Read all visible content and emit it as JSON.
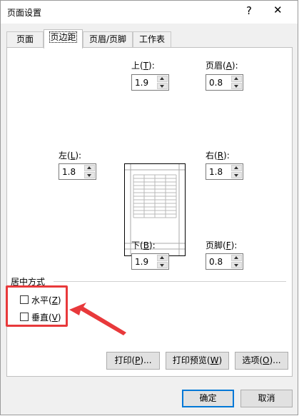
{
  "window": {
    "title": "页面设置",
    "help": "?",
    "close": "✕"
  },
  "tabs": [
    {
      "label": "页面"
    },
    {
      "label": "页边距"
    },
    {
      "label": "页眉/页脚"
    },
    {
      "label": "工作表"
    }
  ],
  "margins": {
    "top": {
      "label": "上(",
      "key": "T",
      "suffix": "):",
      "value": "1.9"
    },
    "header": {
      "label": "页眉(",
      "key": "A",
      "suffix": "):",
      "value": "0.8"
    },
    "left": {
      "label": "左(",
      "key": "L",
      "suffix": "):",
      "value": "1.8"
    },
    "right": {
      "label": "右(",
      "key": "R",
      "suffix": "):",
      "value": "1.8"
    },
    "bottom": {
      "label": "下(",
      "key": "B",
      "suffix": "):",
      "value": "1.9"
    },
    "footer": {
      "label": "页脚(",
      "key": "F",
      "suffix": "):",
      "value": "0.8"
    }
  },
  "centering": {
    "group_label": "居中方式",
    "horizontal": {
      "label": "水平(",
      "key": "Z",
      "suffix": ")",
      "checked": false
    },
    "vertical": {
      "label": "垂直(",
      "key": "V",
      "suffix": ")",
      "checked": false
    }
  },
  "actions": {
    "print": {
      "label": "打印(",
      "key": "P",
      "suffix": ")..."
    },
    "preview": {
      "label": "打印预览(",
      "key": "W",
      "suffix": ")"
    },
    "options": {
      "label": "选项(",
      "key": "O",
      "suffix": ")..."
    }
  },
  "footer_buttons": {
    "ok": "确定",
    "cancel": "取消"
  },
  "annotation": {
    "highlight_color": "#e8393b"
  },
  "colors": {
    "accent": "#0078d7"
  }
}
